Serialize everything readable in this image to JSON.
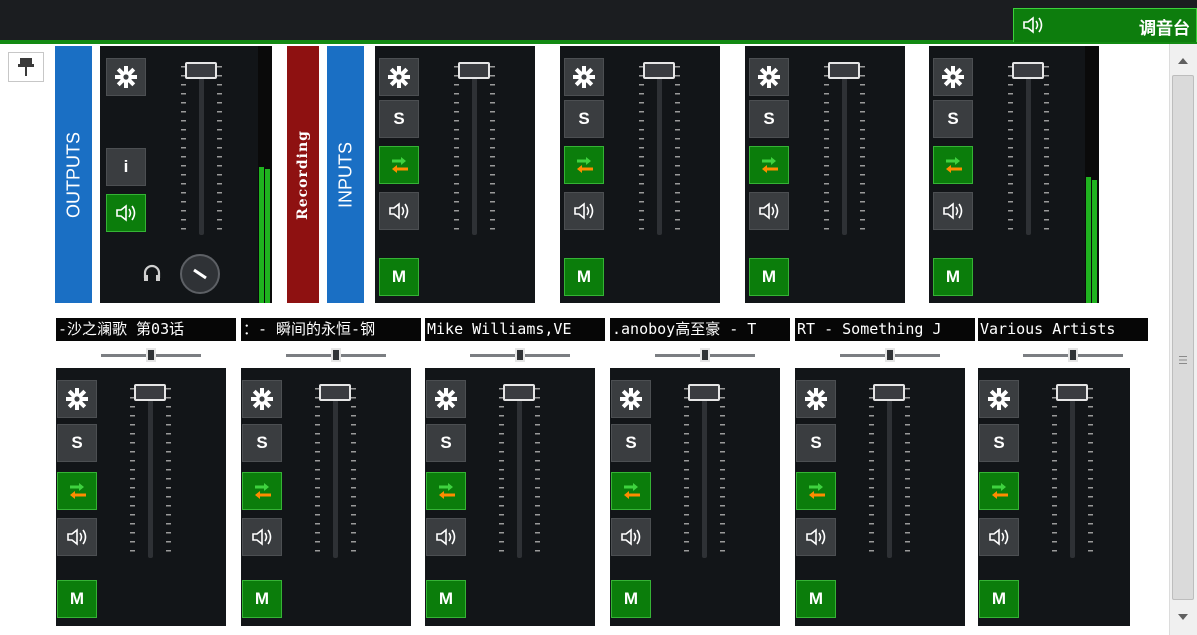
{
  "window": {
    "title": "调音台"
  },
  "labels": {
    "outputs": "OUTPUTS",
    "recording": "Recording",
    "inputs": "INPUTS"
  },
  "buttons": {
    "solo": "S",
    "mute": "M",
    "info": "i"
  },
  "tracks": [
    {
      "title": "-沙之澜歌 第03话"
    },
    {
      "title": "：- 瞬间的永恒-钢"
    },
    {
      "title": "Mike Williams,VE"
    },
    {
      "title": ".anoboy高至豪 - T"
    },
    {
      "title": "RT - Something J"
    },
    {
      "title": "Various Artists"
    }
  ],
  "colors": {
    "accent_green": "#0b7d0b",
    "outputs_blue": "#1a6fc4",
    "recording_red": "#8e1111",
    "strip_bg": "#121518"
  },
  "icons": [
    "gear-icon",
    "speaker-icon",
    "route-arrows-icon",
    "headphones-icon",
    "pin-icon",
    "chevron-up-icon",
    "chevron-down-icon"
  ],
  "meters": {
    "outputs": [
      0.53,
      0.52
    ],
    "inputs_right": [
      0.49,
      0.48
    ]
  }
}
